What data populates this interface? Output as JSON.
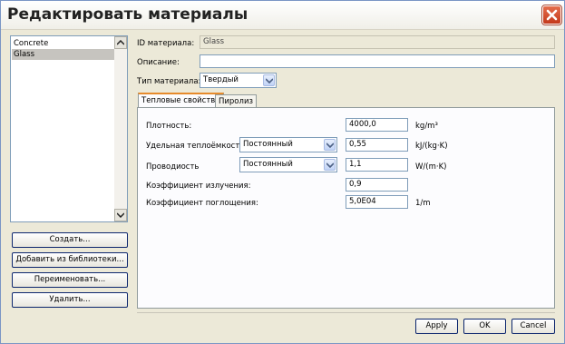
{
  "window": {
    "title": "Редактировать материалы"
  },
  "materials": {
    "items": [
      "Concrete",
      "Glass"
    ],
    "selected": "Glass"
  },
  "left_buttons": {
    "create": "Создать...",
    "add_from_library": "Добавить из библиотеки...",
    "rename": "Переименовать...",
    "delete": "Удалить..."
  },
  "form": {
    "id_label": "ID материала:",
    "id_value": "Glass",
    "description_label": "Описание:",
    "description_value": "",
    "type_label": "Тип материала:",
    "type_value": "Твердый"
  },
  "tabs": {
    "thermal": "Тепловые свойства",
    "pyrolysis": "Пиролиз",
    "active": "thermal"
  },
  "properties": {
    "density": {
      "label": "Плотность:",
      "value": "4000,0",
      "unit": "kg/m³"
    },
    "specific_heat": {
      "label": "Удельная теплоёмкость",
      "mode": "Постоянный",
      "value": "0,55",
      "unit": "kJ/(kg·K)"
    },
    "conductivity": {
      "label": "Проводиость",
      "mode": "Постоянный",
      "value": "1,1",
      "unit": "W/(m·K)"
    },
    "emissivity": {
      "label": "Коэффициент излучения:",
      "value": "0,9"
    },
    "absorption": {
      "label": "Коэффициент поглощения:",
      "value": "5,0E04",
      "unit": "1/m"
    }
  },
  "dialog_buttons": {
    "apply": "Apply",
    "ok": "OK",
    "cancel": "Cancel"
  },
  "colors": {
    "close_button": "#d4492a",
    "active_tab_accent": "#e68b2c",
    "selection": "#c6c4bf"
  },
  "icons": {
    "close": "close-icon",
    "scroll_up": "chevron-up-icon",
    "scroll_down": "chevron-down-icon",
    "dropdown": "chevron-down-icon"
  }
}
